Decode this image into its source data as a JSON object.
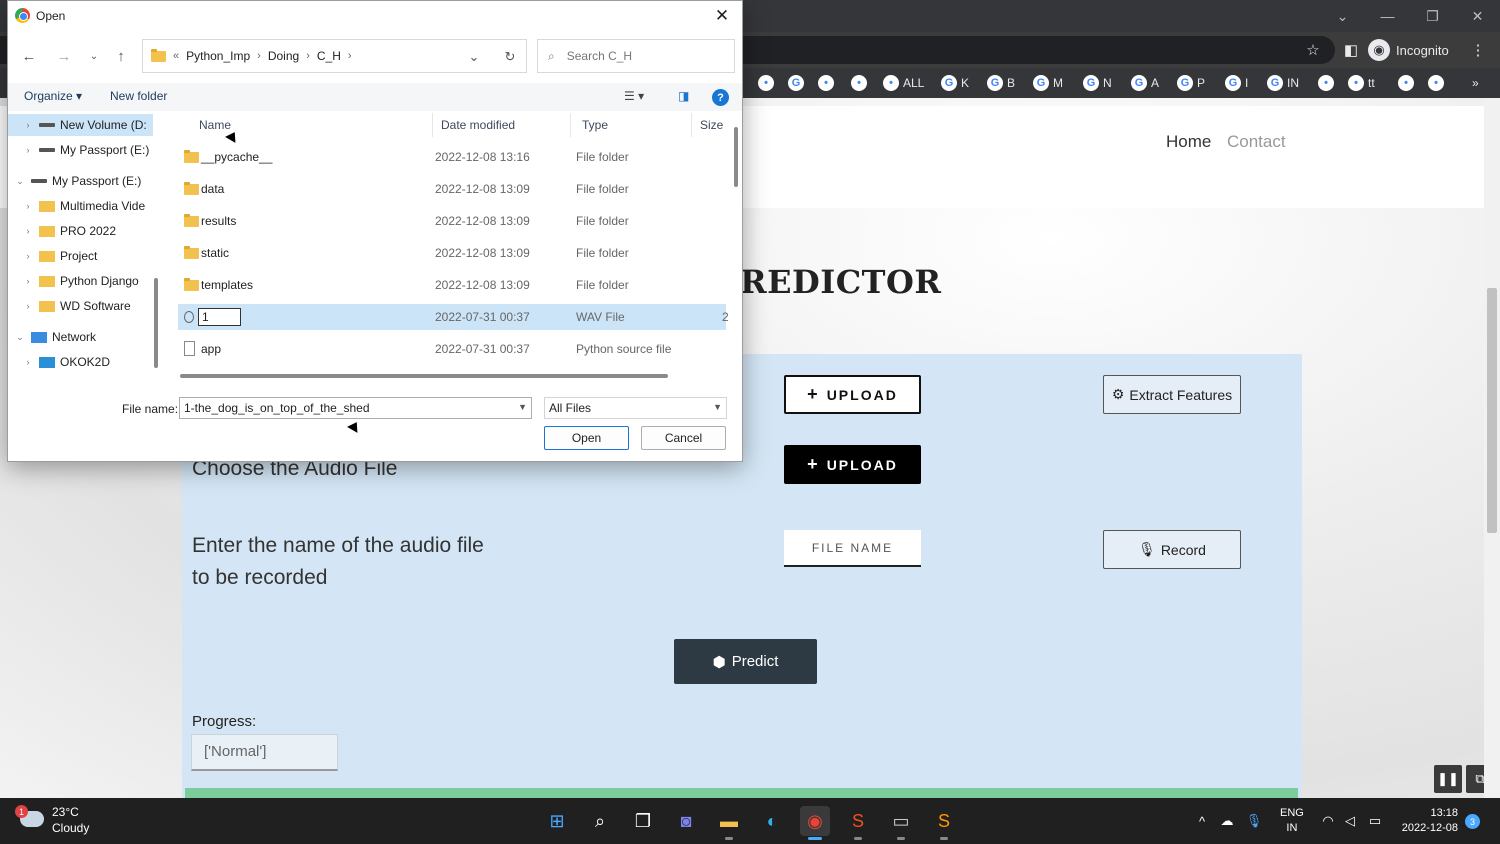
{
  "browser": {
    "incognito_label": "Incognito",
    "bookmarks": [
      {
        "icon": "yandex-icon",
        "label": ""
      },
      {
        "icon": "google-icon",
        "label": ""
      },
      {
        "icon": "plane-icon",
        "label": ""
      },
      {
        "icon": "tag-icon",
        "label": ""
      },
      {
        "icon": "globe-icon",
        "label": "ALL"
      },
      {
        "icon": "google-icon",
        "label": "K"
      },
      {
        "icon": "google-icon",
        "label": "B"
      },
      {
        "icon": "google-icon",
        "label": "M"
      },
      {
        "icon": "google-icon",
        "label": "N"
      },
      {
        "icon": "google-icon",
        "label": "A"
      },
      {
        "icon": "google-icon",
        "label": "P"
      },
      {
        "icon": "google-icon",
        "label": "I"
      },
      {
        "icon": "google-icon",
        "label": "IN"
      },
      {
        "icon": "code-icon",
        "label": ""
      },
      {
        "icon": "monitor-icon",
        "label": "tt"
      },
      {
        "icon": "globe-icon",
        "label": ""
      },
      {
        "icon": "puzzle-icon",
        "label": ""
      }
    ]
  },
  "site": {
    "nav": {
      "home": "Home",
      "contact": "Contact"
    },
    "headline": "REDICTOR",
    "choose_label": "Choose the Audio File",
    "enter_name_line1": "Enter the name of the audio file",
    "enter_name_line2": "to be recorded",
    "upload_label": "UPLOAD",
    "extract_label": "Extract Features",
    "file_name_placeholder": "FILE NAME",
    "record_label": "Record",
    "predict_label": "Predict",
    "progress_label": "Progress:",
    "progress_value": "['Normal']"
  },
  "dialog": {
    "title": "Open",
    "breadcrumb": [
      "Python_Imp",
      "Doing",
      "C_H"
    ],
    "breadcrumb_prefix": "«",
    "search_placeholder": "Search C_H",
    "organize_label": "Organize",
    "new_folder_label": "New folder",
    "tree": [
      {
        "label": "New Volume (D:",
        "icon": "drive-icon",
        "indent": 1,
        "selected": true
      },
      {
        "label": "My Passport (E:)",
        "icon": "drive-icon",
        "indent": 1,
        "selected": false
      },
      {
        "label": "My Passport (E:)",
        "icon": "drive-icon",
        "indent": 0,
        "selected": false,
        "expanded": true
      },
      {
        "label": "Multimedia Vide",
        "icon": "folder-icon",
        "indent": 1,
        "selected": false
      },
      {
        "label": "PRO 2022",
        "icon": "folder-icon",
        "indent": 1,
        "selected": false
      },
      {
        "label": "Project",
        "icon": "folder-icon",
        "indent": 1,
        "selected": false
      },
      {
        "label": "Python Django",
        "icon": "folder-icon",
        "indent": 1,
        "selected": false
      },
      {
        "label": "WD Software",
        "icon": "folder-icon",
        "indent": 1,
        "selected": false
      },
      {
        "label": "Network",
        "icon": "network-icon",
        "indent": 0,
        "selected": false,
        "expanded": true
      },
      {
        "label": "OKOK2D",
        "icon": "computer-icon",
        "indent": 1,
        "selected": false
      }
    ],
    "columns": {
      "name": "Name",
      "date": "Date modified",
      "type": "Type",
      "size": "Size"
    },
    "files": [
      {
        "name": "__pycache__",
        "date": "2022-12-08 13:16",
        "type": "File folder",
        "size": "",
        "icon": "folder-icon"
      },
      {
        "name": "data",
        "date": "2022-12-08 13:09",
        "type": "File folder",
        "size": "",
        "icon": "folder-icon"
      },
      {
        "name": "results",
        "date": "2022-12-08 13:09",
        "type": "File folder",
        "size": "",
        "icon": "folder-icon"
      },
      {
        "name": "static",
        "date": "2022-12-08 13:09",
        "type": "File folder",
        "size": "",
        "icon": "folder-icon"
      },
      {
        "name": "templates",
        "date": "2022-12-08 13:09",
        "type": "File folder",
        "size": "",
        "icon": "folder-icon"
      },
      {
        "name": "1",
        "date": "2022-07-31 00:37",
        "type": "WAV File",
        "size": "2",
        "icon": "audio-file-icon",
        "selected": true,
        "renaming": true
      },
      {
        "name": "app",
        "date": "2022-07-31 00:37",
        "type": "Python source file",
        "size": "",
        "icon": "file-icon"
      }
    ],
    "file_name_label": "File name:",
    "file_name_value": "1-the_dog_is_on_top_of_the_shed",
    "file_type_value": "All Files",
    "open_label": "Open",
    "cancel_label": "Cancel"
  },
  "taskbar": {
    "temperature": "23°C",
    "condition": "Cloudy",
    "weather_badge": "1",
    "language_line1": "ENG",
    "language_line2": "IN",
    "time": "13:18",
    "date": "2022-12-08",
    "notification_count": "3"
  },
  "colors": {
    "panel": "#d4e6f5",
    "accent_blue": "#1976d2",
    "selected_row": "#cce4f7",
    "predict_button": "#2d3a44",
    "green_bar": "#7ccb9b"
  }
}
